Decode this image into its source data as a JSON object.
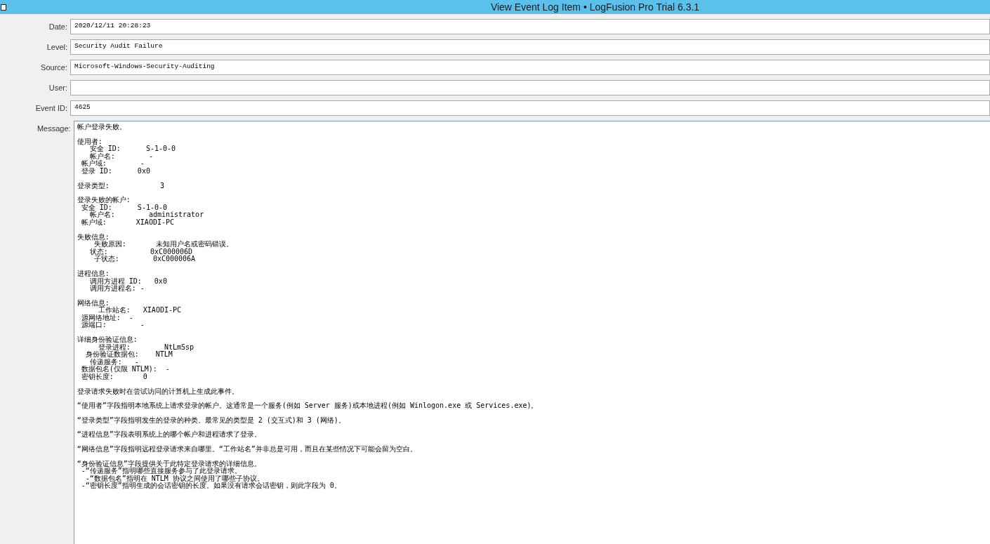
{
  "window": {
    "title": "View Event Log Item • LogFusion Pro Trial 6.3.1"
  },
  "fields": [
    {
      "label": "Date:",
      "value": "2020/12/11 20:28:23"
    },
    {
      "label": "Level:",
      "value": "Security Audit Failure"
    },
    {
      "label": "Source:",
      "value": "Microsoft-Windows-Security-Auditing"
    },
    {
      "label": "User:"
    },
    {
      "label": "Event ID:",
      "value": "4625"
    }
  ],
  "message": {
    "label": "Message:",
    "paragraphs": [
      [
        "帐户登录失败。"
      ],
      [
        "使用者:",
        "   安全 ID:      S-1-0-0",
        "   帐户名:        -",
        " 帐户域:        -",
        " 登录 ID:      0x0"
      ],
      [
        "登录类型:            3"
      ],
      [
        "登录失败的帐户:",
        " 安全 ID:      S-1-0-0",
        "   帐户名:        administrator",
        " 帐户域:       XIAODI-PC"
      ],
      [
        "失败信息:",
        "    失败原因:       未知用户名或密码错误。",
        "   状态:          0xC000006D",
        "    子状态:        0xC000006A"
      ],
      [
        "进程信息:",
        "   调用方进程 ID:   0x0",
        "   调用方进程名: -"
      ],
      [
        "网络信息:",
        "     工作站名:   XIAODI-PC",
        " 源网络地址:  -",
        " 源端口:        -"
      ],
      [
        "详细身份验证信息:",
        "     登录进程:        NtLmSsp",
        "  身份验证数据包:    NTLM",
        "   传递服务:   -",
        " 数据包名(仅限 NTLM):  -",
        " 密钥长度:       0"
      ],
      [
        "登录请求失败时在尝试访问的计算机上生成此事件。"
      ],
      [
        "“使用者”字段指明本地系统上请求登录的帐户。这通常是一个服务(例如 Server 服务)或本地进程(例如 Winlogon.exe 或 Services.exe)。"
      ],
      [
        "“登录类型”字段指明发生的登录的种类。最常见的类型是 2 (交互式)和 3 (网络)。"
      ],
      [
        "“进程信息”字段表明系统上的哪个帐户和进程请求了登录。"
      ],
      [
        "“网络信息”字段指明远程登录请求来自哪里。“工作站名”并非总是可用，而且在某些情况下可能会留为空白。"
      ],
      [
        "“身份验证信息”字段提供关于此特定登录请求的详细信息。",
        " -“传递服务”指明哪些直接服务参与了此登录请求。",
        "  -“数据包名”指明在 NTLM 协议之间使用了哪些子协议。",
        " -“密钥长度”指明生成的会话密钥的长度。如果没有请求会话密钥，则此字段为 0。"
      ]
    ]
  }
}
